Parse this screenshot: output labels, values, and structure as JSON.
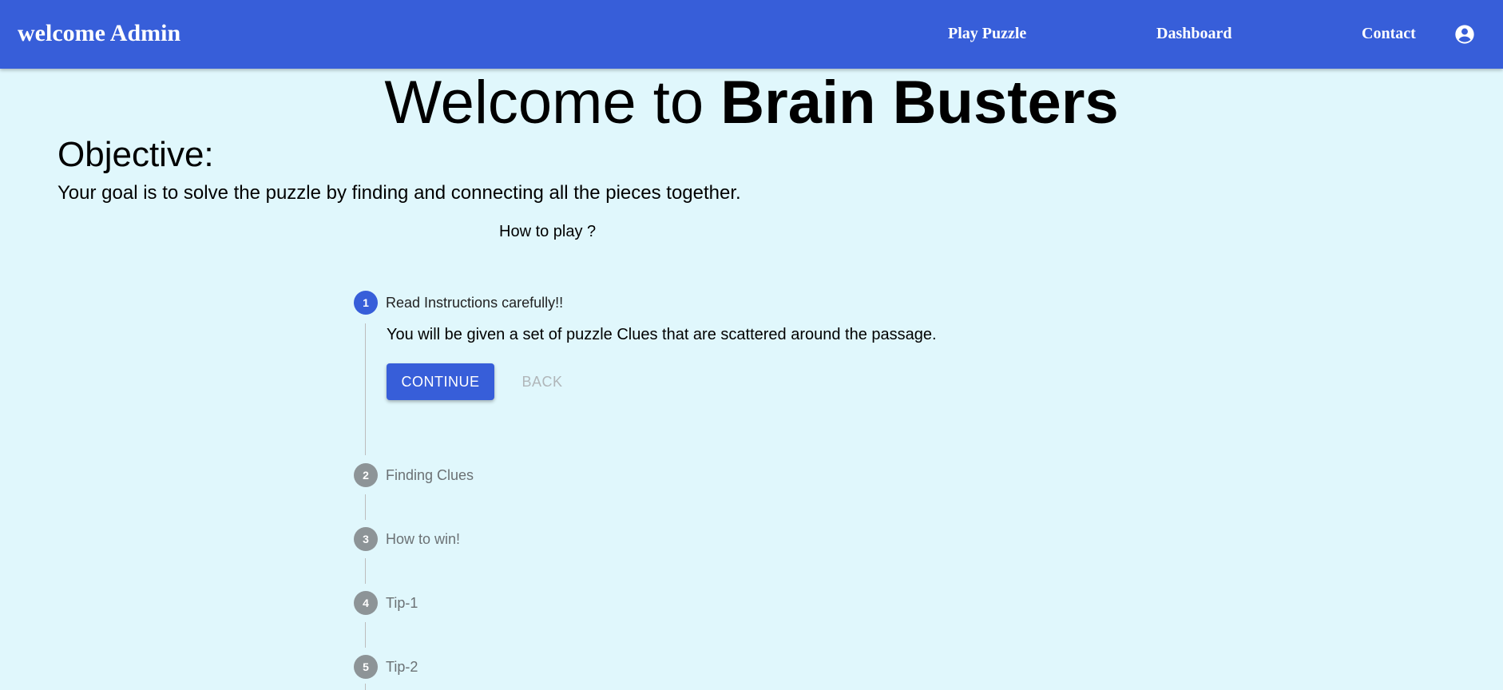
{
  "navbar": {
    "brand": "welcome Admin",
    "links": [
      {
        "label": "Play Puzzle"
      },
      {
        "label": "Dashboard"
      },
      {
        "label": "Contact"
      }
    ],
    "account_icon": "account-circle-icon"
  },
  "hero": {
    "prefix": "Welcome to ",
    "bold": "Brain Busters"
  },
  "objective": {
    "heading": "Objective:",
    "text": "Your goal is to solve the puzzle by finding and connecting all the pieces together."
  },
  "how_to_play": "How to play ?",
  "stepper": {
    "active_step": 1,
    "steps": [
      {
        "number": "1",
        "label": "Read Instructions carefully!!",
        "content": "You will be given a set of puzzle Clues that are scattered around the passage."
      },
      {
        "number": "2",
        "label": "Finding Clues"
      },
      {
        "number": "3",
        "label": "How to win!"
      },
      {
        "number": "4",
        "label": "Tip-1"
      },
      {
        "number": "5",
        "label": "Tip-2"
      }
    ],
    "continue_label": "CONTINUE",
    "back_label": "BACK"
  },
  "colors": {
    "primary": "#375ed9",
    "background": "#e0f7fc",
    "inactive_step": "#8d9497"
  }
}
